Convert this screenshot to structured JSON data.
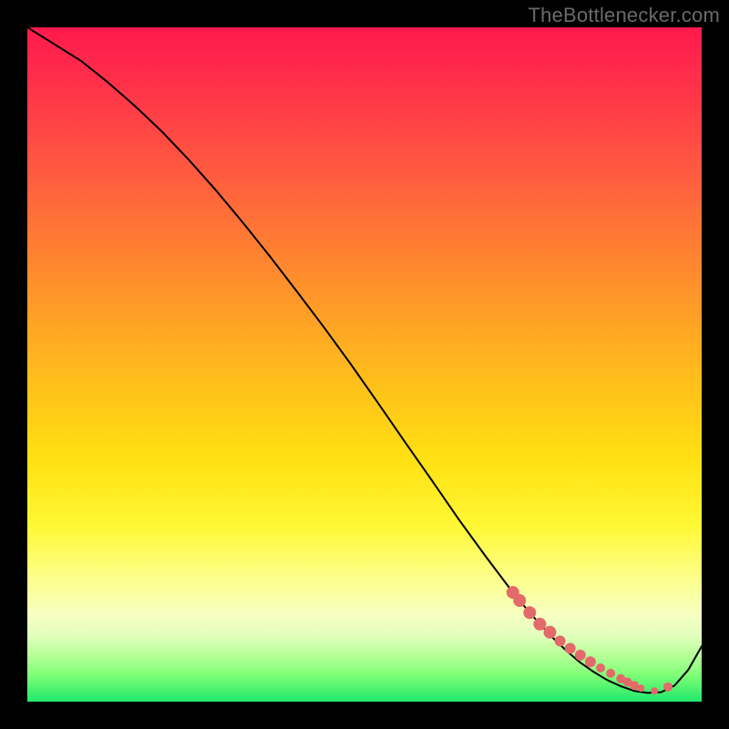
{
  "watermark": "TheBottlenecker.com",
  "colors": {
    "background": "#000000",
    "gradient_top": "#ff1a4d",
    "gradient_mid": "#ffe012",
    "gradient_bottom": "#20e86b",
    "curve": "#000000",
    "points": "#e46a6a"
  },
  "chart_data": {
    "type": "line",
    "title": "",
    "xlabel": "",
    "ylabel": "",
    "xlim": [
      0,
      100
    ],
    "ylim": [
      0,
      100
    ],
    "x": [
      0,
      4,
      8,
      12,
      16,
      20,
      24,
      28,
      32,
      36,
      40,
      44,
      48,
      52,
      56,
      60,
      64,
      68,
      72,
      74,
      76,
      78,
      80,
      82,
      84,
      86,
      88,
      90,
      92,
      94,
      96,
      98,
      100
    ],
    "values": [
      100,
      97.5,
      95,
      91.8,
      88.3,
      84.5,
      80.3,
      75.8,
      71,
      66,
      60.8,
      55.5,
      50,
      44.3,
      38.5,
      32.8,
      27,
      21.5,
      16.2,
      13.8,
      11.5,
      9.4,
      7.5,
      5.8,
      4.4,
      3.2,
      2.3,
      1.6,
      1.3,
      1.4,
      2.4,
      4.7,
      8.2
    ],
    "highlight_points": {
      "x": [
        72,
        73,
        74.5,
        76,
        77.5,
        79,
        80.5,
        82,
        83.5,
        85,
        86.5,
        88,
        89,
        90,
        91,
        93,
        95
      ],
      "y": [
        16.2,
        15.0,
        13.2,
        11.5,
        10.3,
        9.0,
        7.9,
        6.9,
        5.9,
        5.0,
        4.2,
        3.4,
        2.9,
        2.4,
        2.0,
        1.6,
        2.2
      ],
      "r": [
        7,
        7,
        7,
        7,
        7,
        6,
        6,
        6,
        6,
        5,
        5,
        5,
        5,
        5,
        4,
        4,
        5
      ]
    }
  }
}
